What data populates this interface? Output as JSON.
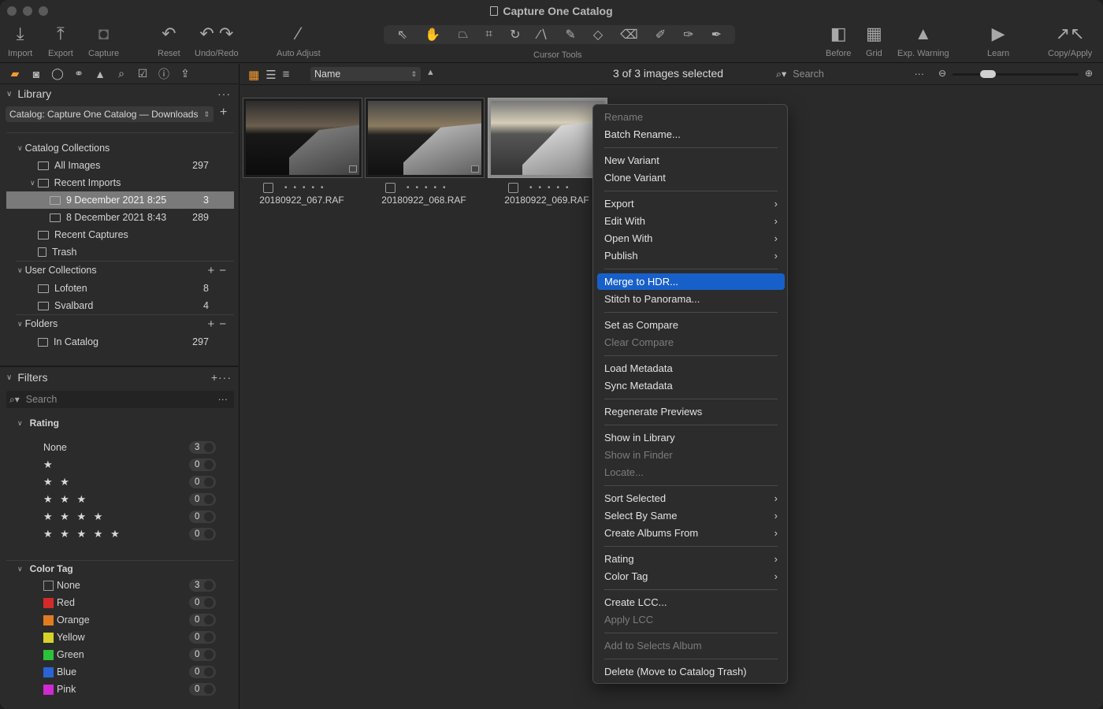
{
  "window": {
    "title": "Capture One Catalog"
  },
  "toolbar": {
    "import": "Import",
    "export": "Export",
    "capture": "Capture",
    "reset": "Reset",
    "undo_redo": "Undo/Redo",
    "auto_adjust": "Auto Adjust",
    "cursor_tools": "Cursor Tools",
    "before": "Before",
    "grid": "Grid",
    "exp_warning": "Exp. Warning",
    "learn": "Learn",
    "copy_apply": "Copy/Apply"
  },
  "library": {
    "title": "Library",
    "catalog_select": "Catalog: Capture One Catalog — Downloads",
    "catalog_collections": "Catalog Collections",
    "all_images": {
      "label": "All Images",
      "count": "297"
    },
    "recent_imports": "Recent Imports",
    "import1": {
      "label": "9 December 2021 8:25",
      "count": "3"
    },
    "import2": {
      "label": "8 December 2021 8:43",
      "count": "289"
    },
    "recent_captures": "Recent Captures",
    "trash": "Trash",
    "user_collections": "User Collections",
    "lofoten": {
      "label": "Lofoten",
      "count": "8"
    },
    "svalbard": {
      "label": "Svalbard",
      "count": "4"
    },
    "folders": "Folders",
    "in_catalog": {
      "label": "In Catalog",
      "count": "297"
    }
  },
  "filters": {
    "title": "Filters",
    "search_placeholder": "Search",
    "rating_title": "Rating",
    "ratings": [
      {
        "label": "None",
        "count": "3"
      },
      {
        "label": "★",
        "count": "0"
      },
      {
        "label": "★ ★",
        "count": "0"
      },
      {
        "label": "★ ★ ★",
        "count": "0"
      },
      {
        "label": "★ ★ ★ ★",
        "count": "0"
      },
      {
        "label": "★ ★ ★ ★ ★",
        "count": "0"
      }
    ],
    "color_tag_title": "Color Tag",
    "color_tags": [
      {
        "label": "None",
        "count": "3",
        "color": ""
      },
      {
        "label": "Red",
        "count": "0",
        "color": "#d42a2a"
      },
      {
        "label": "Orange",
        "count": "0",
        "color": "#e07b1f"
      },
      {
        "label": "Yellow",
        "count": "0",
        "color": "#d7d22a"
      },
      {
        "label": "Green",
        "count": "0",
        "color": "#2cc23a"
      },
      {
        "label": "Blue",
        "count": "0",
        "color": "#2a63d6"
      },
      {
        "label": "Pink",
        "count": "0",
        "color": "#cf2ad1"
      }
    ]
  },
  "browser": {
    "sort_by": "Name",
    "selection_count": "3 of 3 images selected",
    "search_placeholder": "Search",
    "images": [
      {
        "filename": "20180922_067.RAF"
      },
      {
        "filename": "20180922_068.RAF"
      },
      {
        "filename": "20180922_069.RAF"
      }
    ]
  },
  "context_menu": {
    "rename": "Rename",
    "batch_rename": "Batch Rename...",
    "new_variant": "New Variant",
    "clone_variant": "Clone Variant",
    "export": "Export",
    "edit_with": "Edit With",
    "open_with": "Open With",
    "publish": "Publish",
    "merge_hdr": "Merge to HDR...",
    "stitch_panorama": "Stitch to Panorama...",
    "set_compare": "Set as Compare",
    "clear_compare": "Clear Compare",
    "load_metadata": "Load Metadata",
    "sync_metadata": "Sync Metadata",
    "regen_previews": "Regenerate Previews",
    "show_library": "Show in Library",
    "show_finder": "Show in Finder",
    "locate": "Locate...",
    "sort_selected": "Sort Selected",
    "select_by_same": "Select By Same",
    "create_albums_from": "Create Albums From",
    "rating": "Rating",
    "color_tag": "Color Tag",
    "create_lcc": "Create LCC...",
    "apply_lcc": "Apply LCC",
    "add_selects": "Add to Selects Album",
    "delete": "Delete (Move to Catalog Trash)"
  },
  "colors": {
    "accent": "#f29a2e",
    "highlight": "#1860c9"
  }
}
